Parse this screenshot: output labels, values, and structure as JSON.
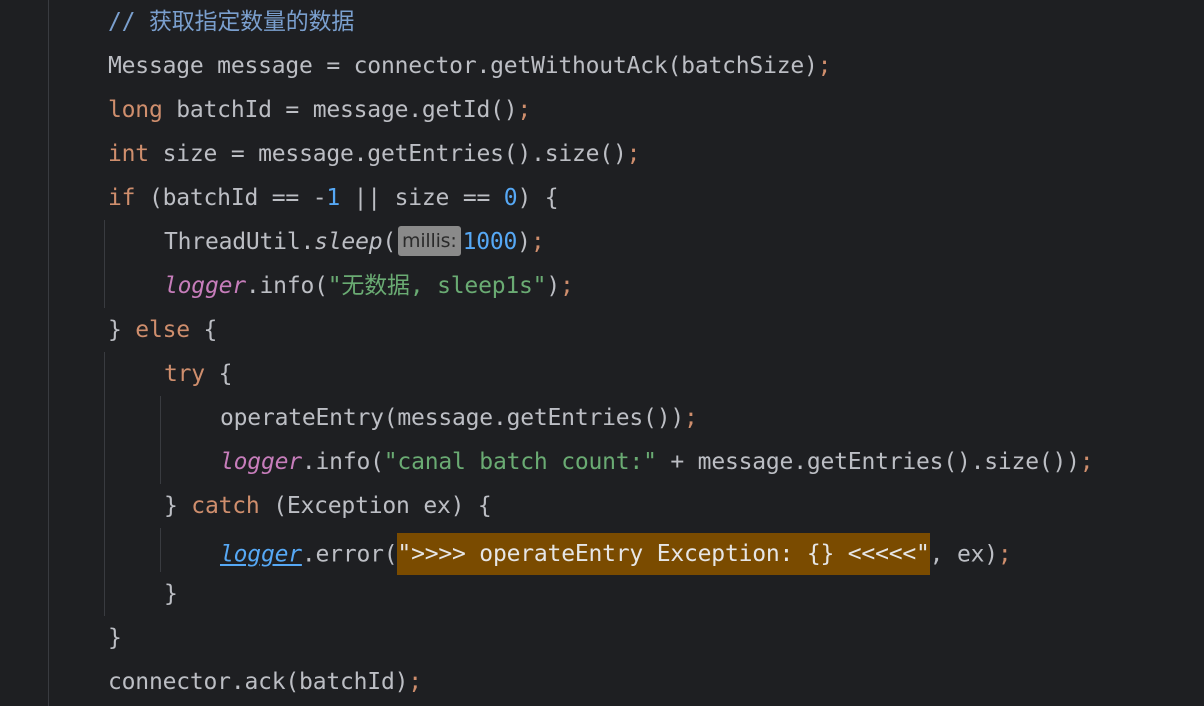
{
  "editor": {
    "lines": [
      {
        "comment": "// 获取指定数量的数据"
      },
      {
        "type": "Message",
        "var": " message = connector.getWithoutAck(batchSize)",
        "semi": ";"
      },
      {
        "kw": "long",
        "rest": " batchId = message.getId()",
        "semi": ";"
      },
      {
        "kw": "int",
        "rest": " size = message.getEntries().size()",
        "semi": ";"
      },
      {
        "kw": "if",
        "a": " (batchId == -",
        "n1": "1",
        "b": " || size == ",
        "n2": "0",
        "c": ") {"
      },
      {
        "a": "ThreadUtil.",
        "call": "sleep",
        "b": "(",
        "hint": "millis:",
        "num": "1000",
        "c": ")",
        "semi": ";"
      },
      {
        "field": "logger",
        "a": ".info(",
        "str": "\"无数据, sleep1s\"",
        "b": ")",
        "semi": ";"
      },
      {
        "a": "} ",
        "kw": "else",
        "b": " {"
      },
      {
        "kw": "try",
        "b": " {"
      },
      {
        "a": "operateEntry(message.getEntries())",
        "semi": ";"
      },
      {
        "field": "logger",
        "a": ".info(",
        "str": "\"canal batch count:\"",
        "b": " + message.getEntries().size())",
        "semi": ";"
      },
      {
        "a": "} ",
        "kw": "catch",
        "b": " (Exception ex) {"
      },
      {
        "field": "logger",
        "a": ".error(",
        "str": "\">>>> operateEntry Exception: {} <<<<<\"",
        "b": ", ex)",
        "semi": ";"
      },
      {
        "a": "}"
      },
      {
        "a": "}"
      },
      {
        "a": "connector.ack(batchId)",
        "semi": ";"
      }
    ]
  }
}
